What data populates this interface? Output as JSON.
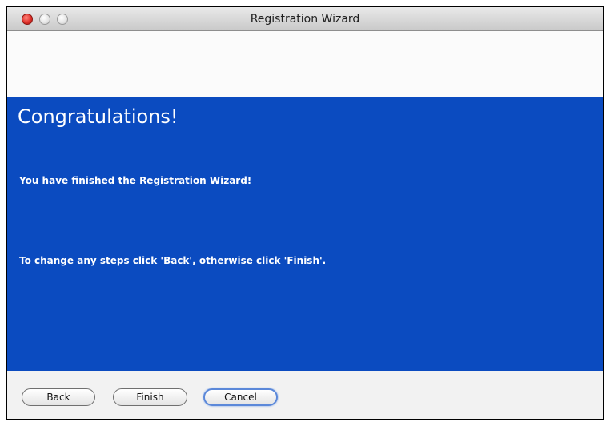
{
  "window": {
    "title": "Registration Wizard"
  },
  "panel": {
    "heading": "Congratulations!",
    "message1": "You have finished the Registration Wizard!",
    "message2": "To change any steps click 'Back', otherwise click 'Finish'.",
    "background_color": "#0b4bc0"
  },
  "buttons": {
    "back_label": "Back",
    "finish_label": "Finish",
    "cancel_label": "Cancel"
  },
  "icons": {
    "close": "close-icon",
    "minimize": "minimize-icon",
    "zoom": "zoom-icon"
  }
}
